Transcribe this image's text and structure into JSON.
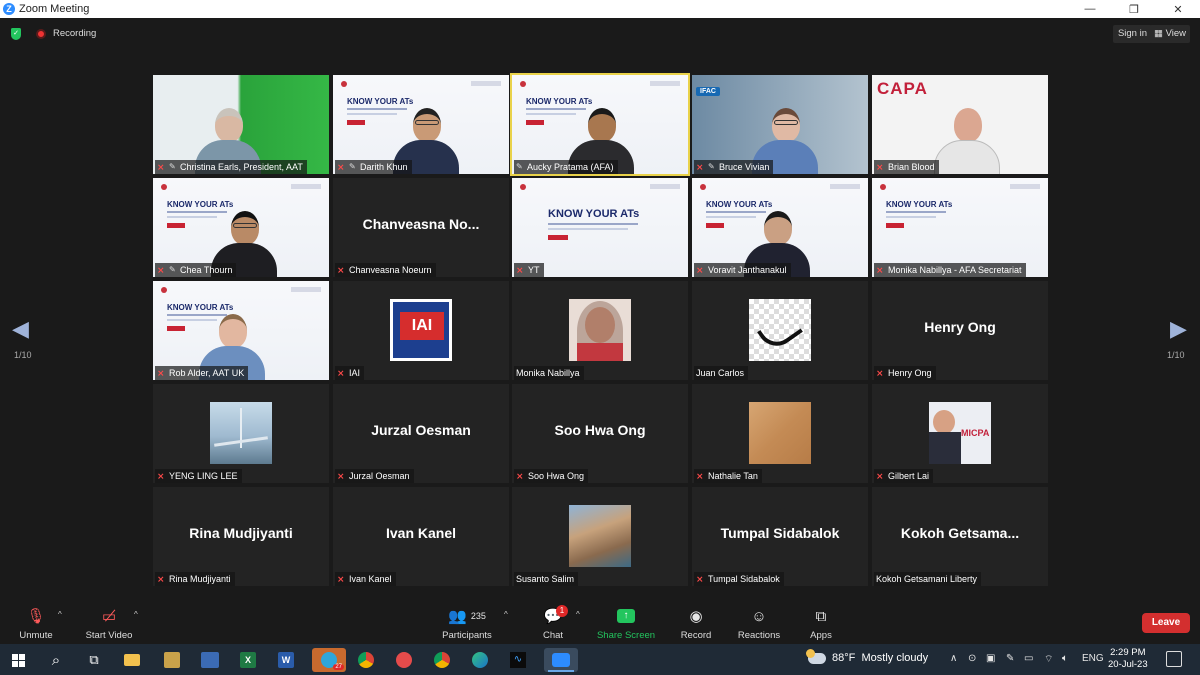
{
  "window": {
    "title": "Zoom Meeting",
    "minimize": "—",
    "maximize": "❐",
    "close": "✕"
  },
  "topbar": {
    "recording_label": "Recording",
    "signin_label": "Sign in",
    "view_label": "View"
  },
  "gallery": {
    "page_left": "1/10",
    "page_right": "1/10",
    "tiles": [
      {
        "name": "Christina Earls, President, AAT",
        "muted": true,
        "pinned": true,
        "type": "video"
      },
      {
        "name": "Darith Khun",
        "muted": true,
        "pinned": true,
        "type": "slide"
      },
      {
        "name": "Aucky Pratama (AFA)",
        "muted": false,
        "pinned": true,
        "type": "slide",
        "active": true
      },
      {
        "name": "Bruce Vivian",
        "muted": true,
        "pinned": true,
        "type": "video",
        "tag": "IFAC"
      },
      {
        "name": "Brian Blood",
        "muted": true,
        "pinned": false,
        "type": "video",
        "tag": "CAPA"
      },
      {
        "name": "Chea Thourn",
        "muted": true,
        "pinned": true,
        "type": "slide"
      },
      {
        "name": "Chanveasna Noeurn",
        "muted": true,
        "pinned": false,
        "type": "name",
        "display": "Chanveasna No..."
      },
      {
        "name": "YT",
        "muted": true,
        "pinned": false,
        "type": "slide-big",
        "heading": "KNOW YOUR ATs"
      },
      {
        "name": "Voravit Janthanakul",
        "muted": true,
        "pinned": false,
        "type": "slide"
      },
      {
        "name": "Monika Nabillya - AFA Secretariat",
        "muted": true,
        "pinned": false,
        "type": "slide"
      },
      {
        "name": "Rob Alder, AAT UK",
        "muted": true,
        "pinned": false,
        "type": "slide"
      },
      {
        "name": "IAI",
        "muted": true,
        "pinned": false,
        "type": "avatar",
        "tag": "IAI"
      },
      {
        "name": "Monika Nabillya",
        "muted": false,
        "pinned": false,
        "type": "avatar"
      },
      {
        "name": "Juan Carlos",
        "muted": false,
        "pinned": false,
        "type": "avatar"
      },
      {
        "name": "Henry Ong",
        "muted": true,
        "pinned": false,
        "type": "name",
        "display": "Henry Ong"
      },
      {
        "name": "YENG LING LEE",
        "muted": true,
        "pinned": false,
        "type": "avatar"
      },
      {
        "name": "Jurzal Oesman",
        "muted": true,
        "pinned": false,
        "type": "name",
        "display": "Jurzal Oesman"
      },
      {
        "name": "Soo Hwa Ong",
        "muted": true,
        "pinned": false,
        "type": "name",
        "display": "Soo Hwa Ong"
      },
      {
        "name": "Nathalie Tan",
        "muted": true,
        "pinned": false,
        "type": "avatar"
      },
      {
        "name": "Gilbert Lai",
        "muted": true,
        "pinned": false,
        "type": "avatar",
        "tag": "MICPA"
      },
      {
        "name": "Rina Mudjiyanti",
        "muted": true,
        "pinned": false,
        "type": "name",
        "display": "Rina Mudjiyanti"
      },
      {
        "name": "Ivan Kanel",
        "muted": true,
        "pinned": false,
        "type": "name",
        "display": "Ivan Kanel"
      },
      {
        "name": "Susanto Salim",
        "muted": false,
        "pinned": false,
        "type": "avatar"
      },
      {
        "name": "Tumpal Sidabalok",
        "muted": true,
        "pinned": false,
        "type": "name",
        "display": "Tumpal Sidabalok"
      },
      {
        "name": "Kokoh Getsamani Liberty",
        "muted": false,
        "pinned": false,
        "type": "name",
        "display": "Kokoh  Getsama..."
      }
    ]
  },
  "controls": {
    "unmute": "Unmute",
    "start_video": "Start Video",
    "participants": "Participants",
    "participants_count": "235",
    "chat": "Chat",
    "chat_badge": "1",
    "share_screen": "Share Screen",
    "record": "Record",
    "reactions": "Reactions",
    "apps": "Apps",
    "leave": "Leave"
  },
  "taskbar": {
    "telegram_badge": "27",
    "weather_temp": "88°F",
    "weather_text": "Mostly cloudy",
    "lang": "ENG",
    "time": "2:29 PM",
    "date": "20-Jul-23"
  },
  "colors": {
    "accent": "#2d8cff",
    "active_border": "#e9d24a",
    "leave": "#d32f2f",
    "share": "#23c55e",
    "mute": "#ff4a4a"
  }
}
